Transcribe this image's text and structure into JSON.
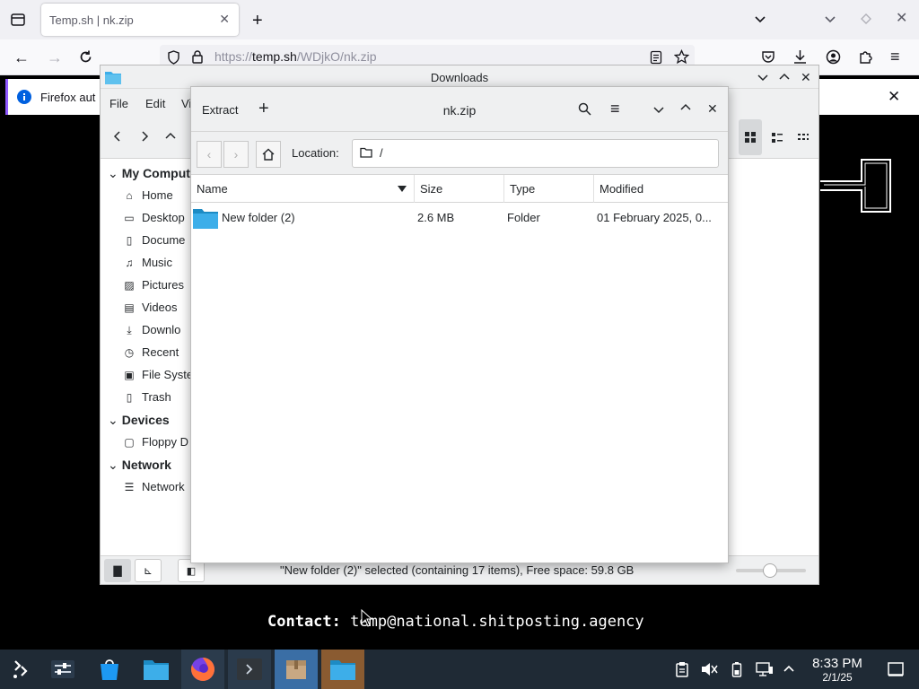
{
  "firefox": {
    "tab_title": "Temp.sh | nk.zip",
    "url_prefix": "https://",
    "url_domain": "temp.sh",
    "url_path": "/WDjkO/nk.zip",
    "infobar_text": "Firefox aut"
  },
  "page": {
    "contact_label": "Contact:",
    "contact_email": "temp@national.shitposting.agency"
  },
  "dolphin": {
    "title": "Downloads",
    "menu": [
      "File",
      "Edit",
      "Vi"
    ],
    "places_header": "My Comput",
    "places": [
      {
        "label": "Home",
        "icon": "home-icon"
      },
      {
        "label": "Desktop",
        "icon": "desktop-icon"
      },
      {
        "label": "Docume",
        "icon": "documents-icon"
      },
      {
        "label": "Music",
        "icon": "music-icon"
      },
      {
        "label": "Pictures",
        "icon": "pictures-icon"
      },
      {
        "label": "Videos",
        "icon": "videos-icon"
      },
      {
        "label": "Downlo",
        "icon": "downloads-icon"
      },
      {
        "label": "Recent",
        "icon": "recent-icon"
      },
      {
        "label": "File Syste",
        "icon": "filesystem-icon"
      },
      {
        "label": "Trash",
        "icon": "trash-icon"
      }
    ],
    "devices_header": "Devices",
    "devices": [
      {
        "label": "Floppy D",
        "icon": "floppy-icon"
      }
    ],
    "network_header": "Network",
    "network": [
      {
        "label": "Network",
        "icon": "network-icon"
      }
    ],
    "status": "\"New folder (2)\" selected (containing 17 items), Free space: 59.8 GB"
  },
  "ark": {
    "extract_label": "Extract",
    "title": "nk.zip",
    "location_label": "Location:",
    "location_value": "/",
    "columns": [
      "Name",
      "Size",
      "Type",
      "Modified"
    ],
    "rows": [
      {
        "name": "New folder (2)",
        "size": "2.6 MB",
        "type": "Folder",
        "modified": "01 February 2025, 0..."
      }
    ]
  },
  "taskbar": {
    "time": "8:33 PM",
    "date": "2/1/25"
  },
  "colors": {
    "accent": "#3daee9",
    "folder": "#3daee9",
    "taskbar": "#1f2a35",
    "firefox_purple": "#9059ff"
  }
}
